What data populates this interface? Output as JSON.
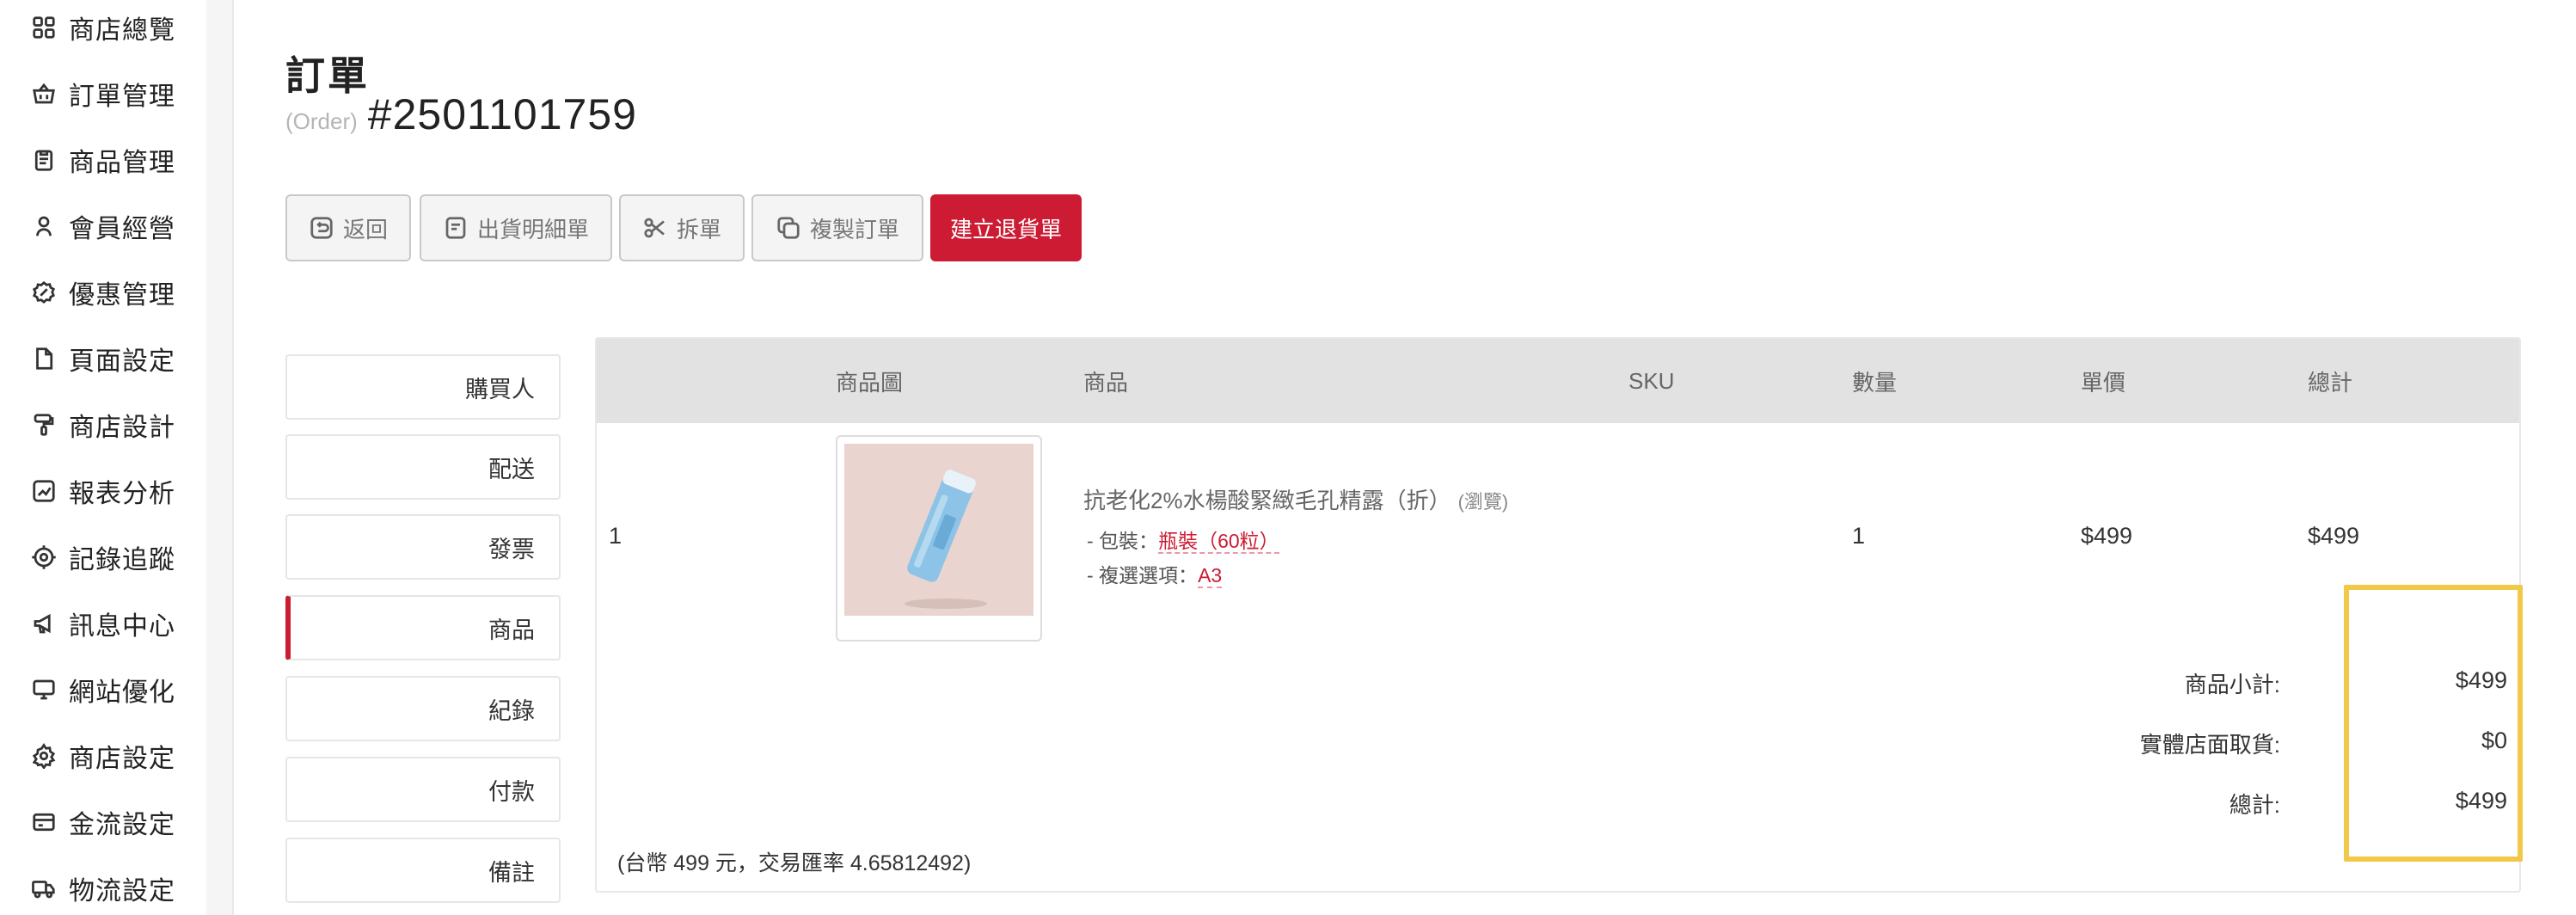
{
  "sidebar": {
    "items": [
      {
        "label": "商店總覽",
        "icon": "grid-icon"
      },
      {
        "label": "訂單管理",
        "icon": "basket-icon"
      },
      {
        "label": "商品管理",
        "icon": "clipboard-icon"
      },
      {
        "label": "會員經營",
        "icon": "user-icon"
      },
      {
        "label": "優惠管理",
        "icon": "badge-icon"
      },
      {
        "label": "頁面設定",
        "icon": "page-icon"
      },
      {
        "label": "商店設計",
        "icon": "brush-icon"
      },
      {
        "label": "報表分析",
        "icon": "chart-icon"
      },
      {
        "label": "記錄追蹤",
        "icon": "target-icon"
      },
      {
        "label": "訊息中心",
        "icon": "megaphone-icon"
      },
      {
        "label": "網站優化",
        "icon": "monitor-icon"
      },
      {
        "label": "商店設定",
        "icon": "gear-icon"
      },
      {
        "label": "金流設定",
        "icon": "card-icon"
      },
      {
        "label": "物流設定",
        "icon": "truck-icon"
      }
    ]
  },
  "header": {
    "title": "訂單",
    "order_prefix": "(Order)",
    "order_number": "#2501101759"
  },
  "actions": {
    "back": "返回",
    "shipping_detail": "出貨明細單",
    "split": "拆單",
    "copy": "複製訂單",
    "create_return": "建立退貨單"
  },
  "tabs": [
    "購買人",
    "配送",
    "發票",
    "商品",
    "紀錄",
    "付款",
    "備註"
  ],
  "active_tab": "商品",
  "table": {
    "columns": {
      "image": "商品圖",
      "product": "商品",
      "sku": "SKU",
      "qty": "數量",
      "unit_price": "單價",
      "total": "總計"
    },
    "rows": [
      {
        "index": "1",
        "name": "抗老化2%水楊酸緊緻毛孔精露（折）",
        "note": "(瀏覽)",
        "options": [
          {
            "label": "- 包裝：",
            "value": "瓶裝（60粒）"
          },
          {
            "label": "- 複選選項：",
            "value": "A3"
          }
        ],
        "sku": "",
        "qty": "1",
        "unit_price": "$499",
        "total": "$499"
      }
    ],
    "summary": [
      {
        "label": "商品小計:",
        "value": "$499"
      },
      {
        "label": "實體店面取貨:",
        "value": "$0"
      },
      {
        "label": "總計:",
        "value": "$499"
      }
    ],
    "footnote": "(台幣 499 元，交易匯率 4.65812492)"
  },
  "colors": {
    "accent": "#cc1b33",
    "highlight": "#f2c84b",
    "header_bg": "#e2e2e2"
  }
}
